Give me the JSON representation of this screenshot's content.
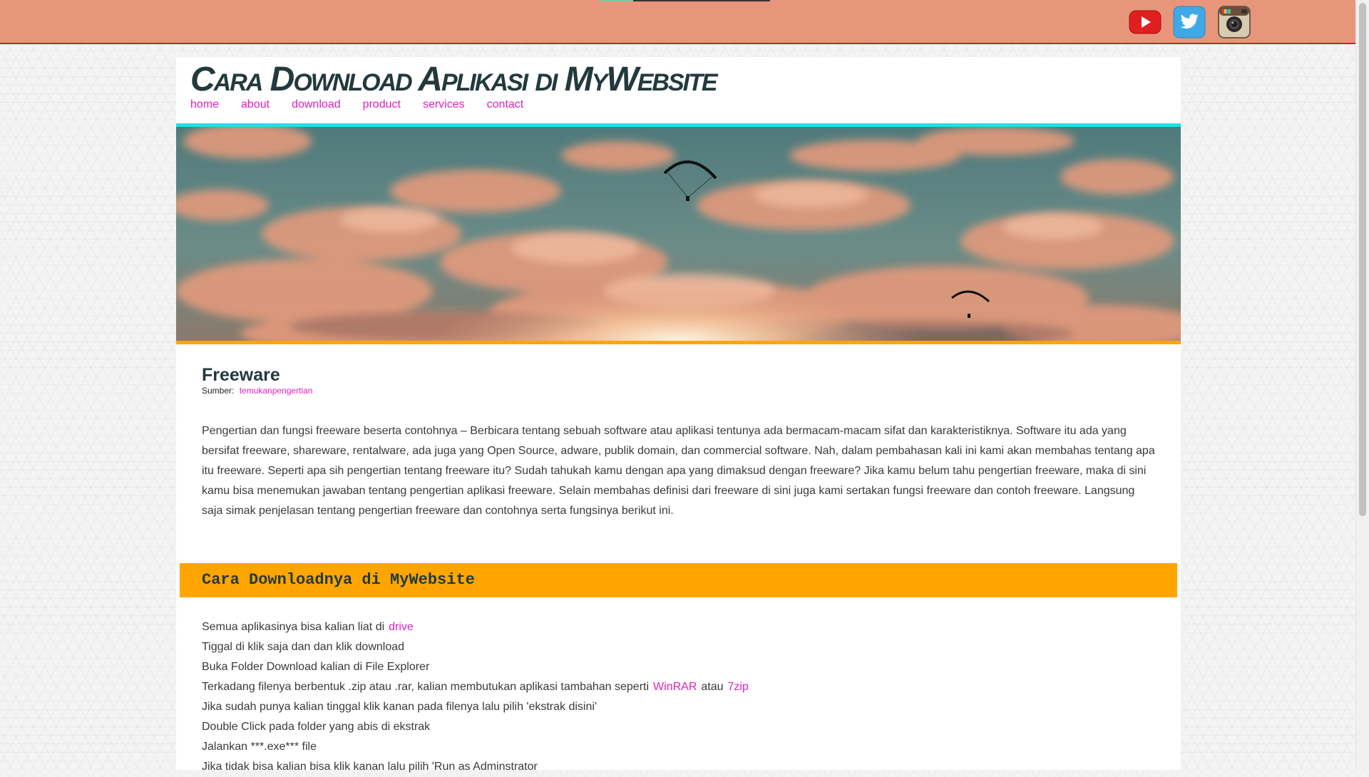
{
  "top_bar": {
    "social": [
      {
        "name": "youtube-icon",
        "label": "YouTube"
      },
      {
        "name": "twitter-icon",
        "label": "Twitter"
      },
      {
        "name": "instagram-icon",
        "label": "Instagram"
      }
    ]
  },
  "header": {
    "site_title": "Cara Download Aplikasi di MyWebsite",
    "nav": [
      "home",
      "about",
      "download",
      "product",
      "services",
      "contact"
    ]
  },
  "article": {
    "title": "Freeware",
    "source_label": "Sumber:",
    "source_link": "temukanpengertian",
    "paragraph": "Pengertian dan fungsi freeware beserta contohnya – Berbicara tentang sebuah software atau aplikasi tentunya ada bermacam-macam sifat dan karakteristiknya. Software itu ada yang bersifat freeware, shareware, rentalware, ada juga yang Open Source, adware, publik domain, dan commercial software. Nah, dalam pembahasan kali ini kami akan membahas tentang apa itu freeware. Seperti apa sih pengertian tentang freeware itu? Sudah tahukah kamu dengan apa yang dimaksud dengan freeware? Jika kamu belum tahu pengertian freeware, maka di sini kamu bisa menemukan jawaban tentang pengertian aplikasi freeware. Selain membahas definisi dari freeware di sini juga kami sertakan fungsi freeware dan contoh freeware. Langsung saja simak penjelasan tentang pengertian freeware dan contohnya serta fungsinya berikut ini."
  },
  "download_section": {
    "title": "Cara Downloadnya di MyWebsite",
    "step1_text": "Semua aplikasinya bisa kalian liat di",
    "step1_link": "drive",
    "step2": "Tiggal di klik saja dan dan klik download",
    "step3": "Buka Folder Download kalian di File Explorer",
    "step4_text": "Terkadang filenya berbentuk .zip atau .rar, kalian membutukan aplikasi tambahan seperti",
    "step4_link1": "WinRAR",
    "step4_mid": "atau",
    "step4_link2": "7zip",
    "step5": "Jika sudah punya kalian tinggal klik kanan pada filenya lalu pilih 'ekstrak disini'",
    "step6": "Double Click pada folder yang abis di ekstrak",
    "step7": "Jalankan ***.exe*** file",
    "step8": "Jika tidak bisa kalian bisa klik kanan lalu pilih 'Run as Adminstrator"
  },
  "colors": {
    "top_bar": "#e8967b",
    "link": "#e01fc0",
    "banner": "#ffa500",
    "hero_top_border": "#22dfe7",
    "heading": "#233a3c"
  }
}
